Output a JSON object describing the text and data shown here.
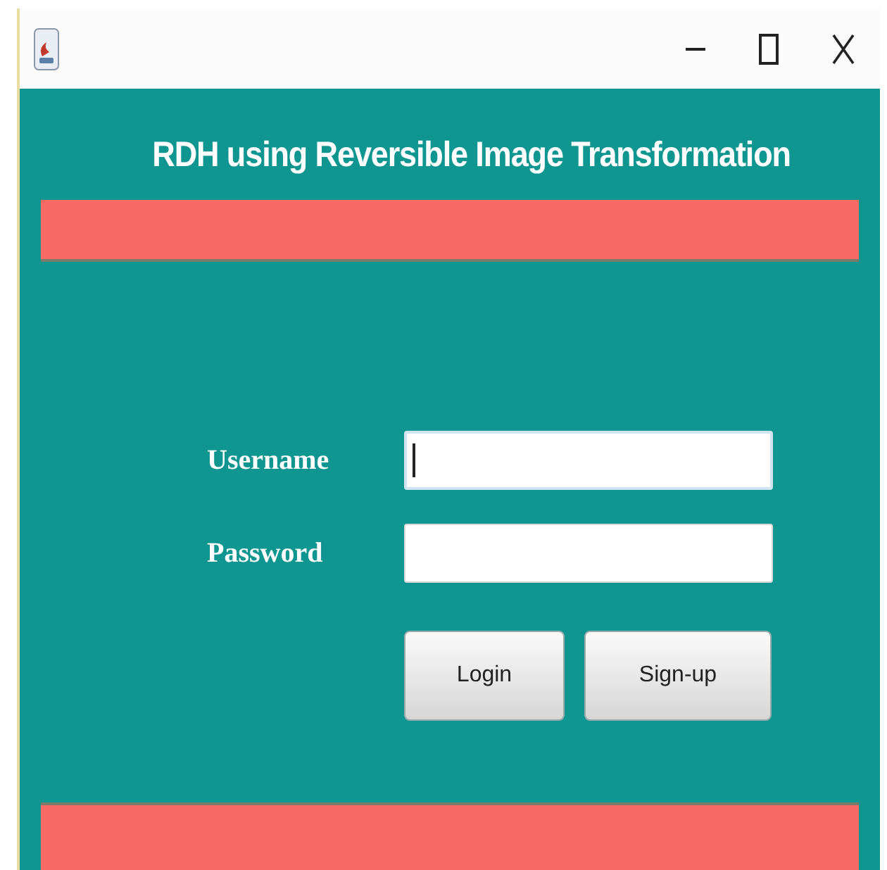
{
  "window": {
    "title_bar_buttons": [
      {
        "kind": "minimize"
      },
      {
        "kind": "maximize"
      },
      {
        "kind": "close"
      }
    ]
  },
  "header": {
    "title": "RDH using Reversible Image Transformation"
  },
  "form": {
    "fields": [
      {
        "label": "Username",
        "focused": true
      },
      {
        "label": "Password",
        "focused": false
      }
    ],
    "buttons": [
      "Login",
      "Sign-up"
    ]
  }
}
